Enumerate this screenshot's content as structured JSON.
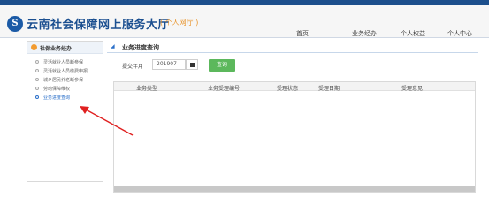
{
  "top_links": [
    "",
    ""
  ],
  "header": {
    "logo_glyph": "S",
    "title": "云南社会保障网上服务大厅",
    "subtitle": "( 个人网厅 )",
    "nav": [
      "首页",
      "业务经办",
      "个人权益",
      "个人中心"
    ]
  },
  "sidebar": {
    "title": "社保业务经办",
    "items": [
      {
        "label": "灵活就业人员断参保",
        "active": false
      },
      {
        "label": "灵活就业人员缴费申报",
        "active": false
      },
      {
        "label": "城乡居民养老断参保",
        "active": false
      },
      {
        "label": "劳动保障维权",
        "active": false
      },
      {
        "label": "业务进度查询",
        "active": true
      }
    ]
  },
  "main": {
    "title": "业务进度查询",
    "form": {
      "month_label": "提交年月",
      "month_value": "201907",
      "query_button": "查询"
    },
    "table": {
      "columns": [
        "业务类型",
        "业务受理编号",
        "受理状态",
        "受理日期",
        "受理意见"
      ],
      "rows": []
    }
  },
  "colors": {
    "brand_blue": "#1b4f90",
    "accent_orange": "#e8942c",
    "query_green": "#5cb85c",
    "annotation_red": "#e02020"
  }
}
